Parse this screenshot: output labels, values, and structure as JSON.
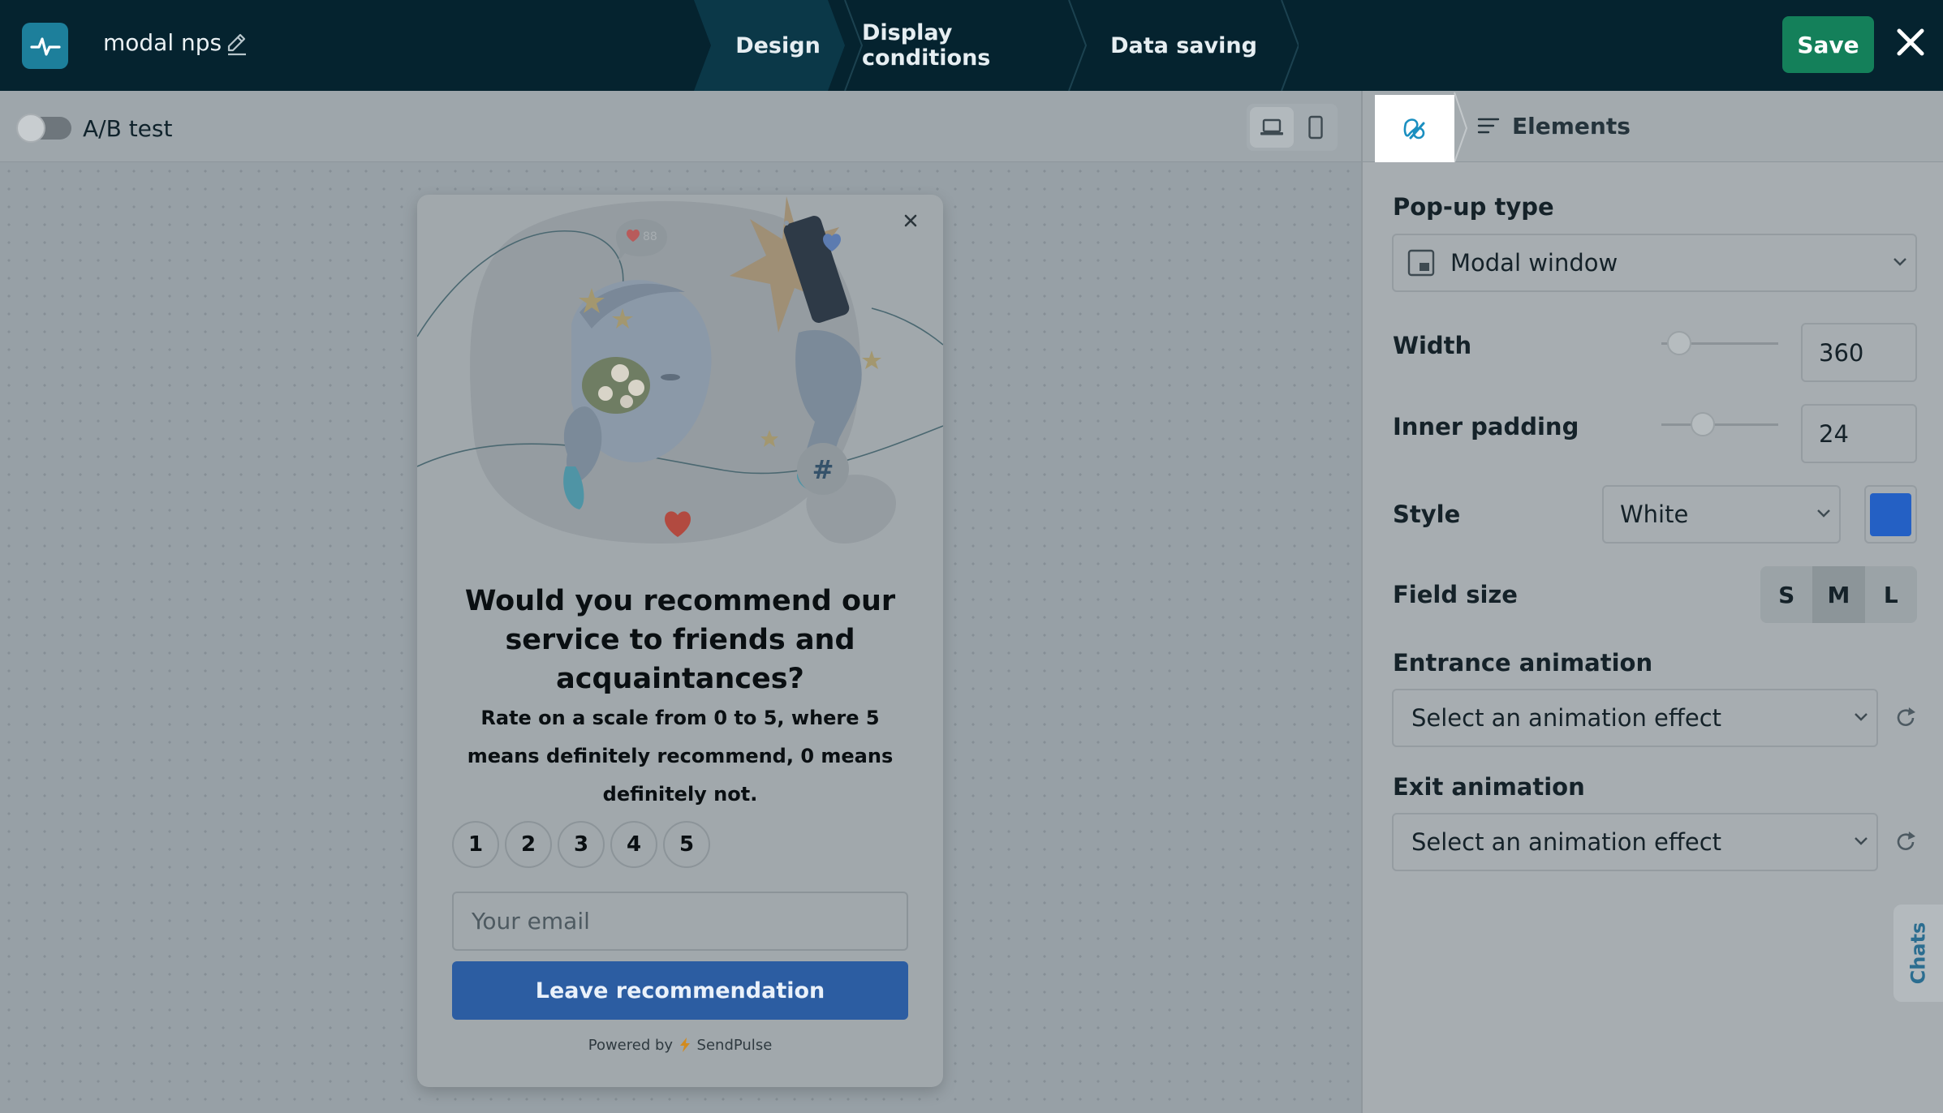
{
  "header": {
    "project_name": "modal nps",
    "steps": [
      "Design",
      "Display conditions",
      "Data saving"
    ],
    "active_step": "Design",
    "save_label": "Save"
  },
  "canvas_toolbar": {
    "ab_test_label": "A/B test",
    "ab_test_enabled": false,
    "view_mode": "desktop"
  },
  "popup": {
    "title": "Would you recommend our service to friends and acquaintances?",
    "description": "Rate on a scale from 0 to 5, where 5 means definitely recommend, 0 means definitely not.",
    "ratings": [
      "1",
      "2",
      "3",
      "4",
      "5"
    ],
    "email_placeholder": "Your email",
    "submit_label": "Leave recommendation",
    "powered_prefix": "Powered by",
    "powered_brand": "SendPulse",
    "colors": {
      "button": "#2c5da2"
    }
  },
  "panel": {
    "tabs": {
      "elements_label": "Elements"
    },
    "popup_type": {
      "label": "Pop-up type",
      "value": "Modal window"
    },
    "width": {
      "label": "Width",
      "value": "360",
      "slider_fraction": 0.18
    },
    "inner_padding": {
      "label": "Inner padding",
      "value": "24",
      "slider_fraction": 0.33
    },
    "style": {
      "label": "Style",
      "value": "White",
      "swatch_color": "#2460c4"
    },
    "field_size": {
      "label": "Field size",
      "options": [
        "S",
        "M",
        "L"
      ],
      "selected": "M"
    },
    "entrance_animation": {
      "label": "Entrance animation",
      "placeholder": "Select an animation effect"
    },
    "exit_animation": {
      "label": "Exit animation",
      "placeholder": "Select an animation effect"
    }
  },
  "chats_label": "Chats"
}
